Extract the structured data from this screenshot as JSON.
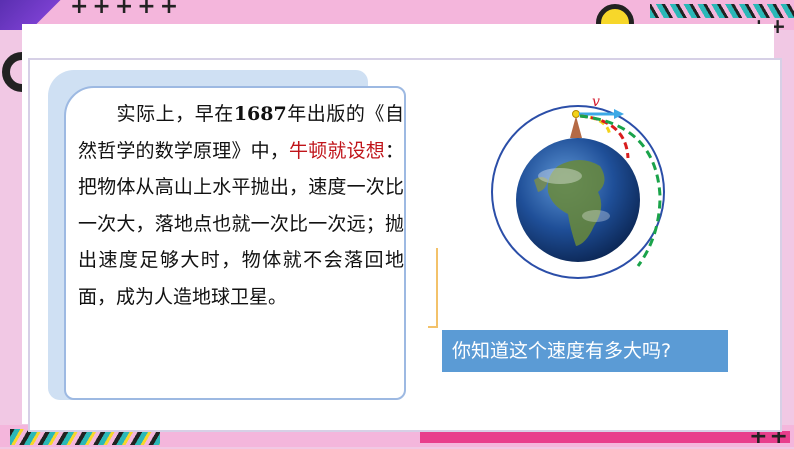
{
  "note": {
    "p1_pre": "实际上，早在",
    "year": "1687",
    "p1_mid": "年出版的《自然哲学的数学原理》中，",
    "highlight": "牛顿就设想",
    "p1_post": "：把物体从高山上水平抛出，速度一次比一次大，落地点也就一次比一次远；抛出速度足够大时，物体就不会落回地面，成为人造地球卫星。"
  },
  "diagram": {
    "velocity_label": "v"
  },
  "question": {
    "text": "你知道这个速度有多大吗?"
  },
  "colors": {
    "highlight": "#c0141a",
    "question_bg": "#5b9bd5",
    "accent_pink": "#e83e8c"
  }
}
